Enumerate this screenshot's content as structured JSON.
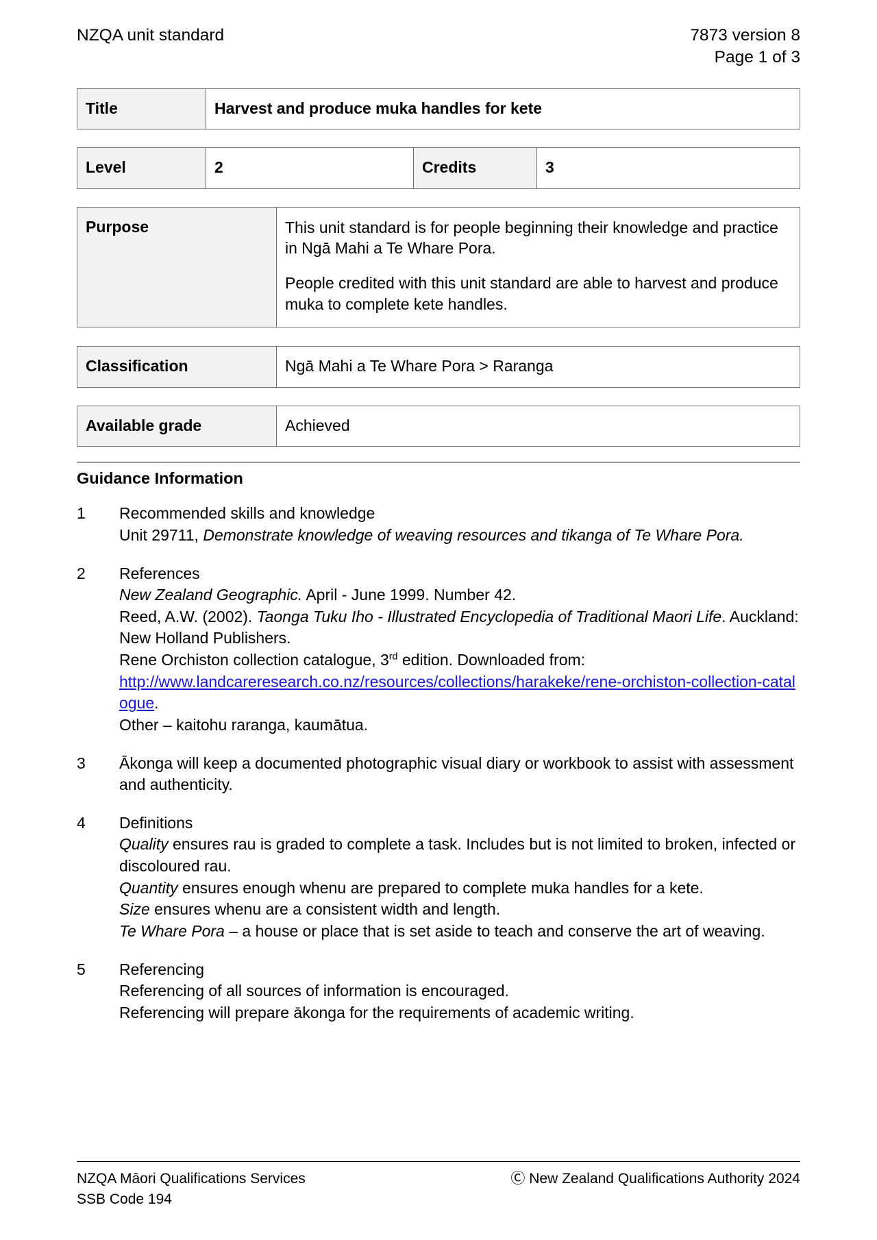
{
  "header": {
    "left": "NZQA unit standard",
    "version": "7873 version 8",
    "page": "Page 1 of 3"
  },
  "info_table": {
    "title_label": "Title",
    "title_value": "Harvest and produce muka handles for kete",
    "level_label": "Level",
    "level_value": "2",
    "credits_label": "Credits",
    "credits_value": "3"
  },
  "purpose": {
    "label": "Purpose",
    "paragraph_1": "This unit standard is for people beginning their knowledge and practice in Ngā Mahi a Te Whare Pora.",
    "paragraph_2": "People credited with this unit standard are able to harvest and produce muka to complete kete handles."
  },
  "classification": {
    "label": "Classification",
    "value": "Ngā Mahi a Te Whare Pora > Raranga"
  },
  "available_grade": {
    "label": "Available grade",
    "value": "Achieved"
  },
  "guidance": {
    "heading": "Guidance Information",
    "items": [
      {
        "number": "1",
        "line_1": "Recommended skills and knowledge",
        "line_2_plain": "Unit 29711, ",
        "line_2_italic": "Demonstrate knowledge of weaving resources and tikanga of Te Whare Pora."
      },
      {
        "number": "2",
        "heading": "References",
        "ref_1_italic": "New Zealand Geographic.",
        "ref_1_plain": " April - June 1999. Number 42.",
        "ref_2_plain_a": "Reed, A.W. (2002). ",
        "ref_2_italic": "Taonga Tuku Iho - Illustrated Encyclopedia of Traditional Maori Life",
        "ref_2_plain_b": ". Auckland: New Holland Publishers.",
        "ref_3_a": "Rene Orchiston collection catalogue, 3",
        "ref_3_sup": "rd",
        "ref_3_b": " edition. Downloaded from:",
        "ref_3_link": "http://www.landcareresearch.co.nz/resources/collections/harakeke/rene-orchiston-collection-catalogue",
        "ref_3_period": ".",
        "ref_4": "Other – kaitohu raranga, kaumātua."
      },
      {
        "number": "3",
        "text": "Ākonga will keep a documented photographic visual diary or workbook to assist with assessment and authenticity."
      },
      {
        "number": "4",
        "heading": "Definitions",
        "def_1_italic": "Quality",
        "def_1_plain": " ensures rau is graded to complete a task.  Includes but is not limited to broken, infected or discoloured rau.",
        "def_2_italic": "Quantity",
        "def_2_plain": " ensures enough whenu are prepared to complete muka handles for a kete.",
        "def_3_italic": "Size",
        "def_3_plain": " ensures whenu are a consistent width and length.",
        "def_4_italic": "Te Whare Pora",
        "def_4_plain": " – a house or place that is set aside to teach and conserve the art of weaving."
      },
      {
        "number": "5",
        "heading": "Referencing",
        "line_1": "Referencing of all sources of information is encouraged.",
        "line_2": "Referencing will prepare ākonga for the requirements of academic writing."
      }
    ]
  },
  "footer": {
    "left_line_1": "NZQA Māori Qualifications Services",
    "left_line_2": "SSB Code 194",
    "right": "Ⓒ New Zealand Qualifications Authority 2024"
  },
  "colors": {
    "label_background": "#f2f2f2",
    "border": "#6f6f6f",
    "link": "#1a18d0"
  }
}
